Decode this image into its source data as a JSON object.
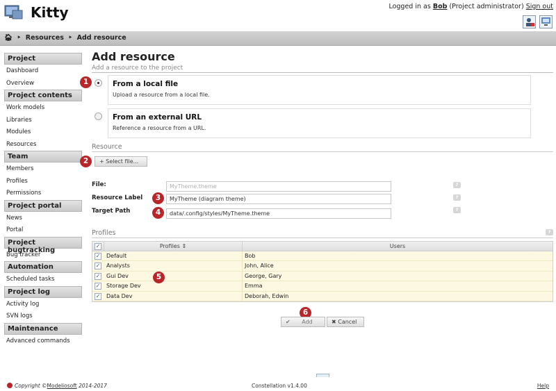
{
  "app": {
    "title": "Kitty",
    "logo_icon": "monitor-folder-icon"
  },
  "header": {
    "logged_in_prefix": "Logged in as",
    "user": "Bob",
    "role": "(Project administrator)",
    "sign_out": "Sign out",
    "icons": [
      "user-settings-icon",
      "desktop-icon"
    ]
  },
  "breadcrumb": {
    "home_icon": "home-icon",
    "items": [
      "Resources",
      "Add resource"
    ]
  },
  "sidebar": {
    "sections": [
      {
        "title": "Project",
        "items": [
          "Dashboard",
          "Overview"
        ]
      },
      {
        "title": "Project contents",
        "items": [
          "Work models",
          "Libraries",
          "Modules",
          "Resources"
        ]
      },
      {
        "title": "Team",
        "items": [
          "Members",
          "Profiles",
          "Permissions"
        ]
      },
      {
        "title": "Project portal",
        "items": [
          "News",
          "Portal"
        ]
      },
      {
        "title": "Project bugtracking",
        "items": [
          "Bug tracker"
        ]
      },
      {
        "title": "Automation",
        "items": [
          "Scheduled tasks"
        ]
      },
      {
        "title": "Project log",
        "items": [
          "Activity log",
          "SVN logs"
        ]
      },
      {
        "title": "Maintenance",
        "items": [
          "Advanced commands"
        ]
      }
    ]
  },
  "page": {
    "title": "Add resource",
    "subtitle": "Add a resource to the project"
  },
  "options": [
    {
      "title": "From a local file",
      "desc": "Upload a resource from a local file.",
      "selected": true
    },
    {
      "title": "From an external URL",
      "desc": "Reference a resource from a URL.",
      "selected": false
    }
  ],
  "resource_section": {
    "heading": "Resource",
    "select_button": "Select file...",
    "file_label": "File:",
    "file_placeholder": "MyTheme.theme",
    "label_label": "Resource Label",
    "label_value": "MyTheme (diagram theme)",
    "path_label": "Target Path",
    "path_value": "data/.config/styles/MyTheme.theme",
    "help": "?"
  },
  "profiles_section": {
    "heading": "Profiles",
    "help": "?",
    "columns": [
      "Profiles",
      "Users"
    ],
    "rows": [
      {
        "profile": "Default",
        "users": "Bob",
        "checked": true
      },
      {
        "profile": "Analysts",
        "users": "John, Alice",
        "checked": true
      },
      {
        "profile": "Gui Dev",
        "users": "George, Gary",
        "checked": true
      },
      {
        "profile": "Storage Dev",
        "users": "Emma",
        "checked": true
      },
      {
        "profile": "Data Dev",
        "users": "Deborah, Edwin",
        "checked": true
      }
    ]
  },
  "actions": {
    "add": "Add",
    "cancel": "Cancel"
  },
  "step_markers": [
    "1",
    "2",
    "3",
    "4",
    "5",
    "6"
  ],
  "footer": {
    "copyright_prefix": "Copyright ©",
    "company": "Modeliosoft",
    "years": "2014-2017",
    "version": "Constellation v1.4.00",
    "help": "Help"
  },
  "colors": {
    "accent_red": "#b9262a",
    "row_highlight": "#fdf8e2",
    "header_gray": "#c9c9c9"
  }
}
